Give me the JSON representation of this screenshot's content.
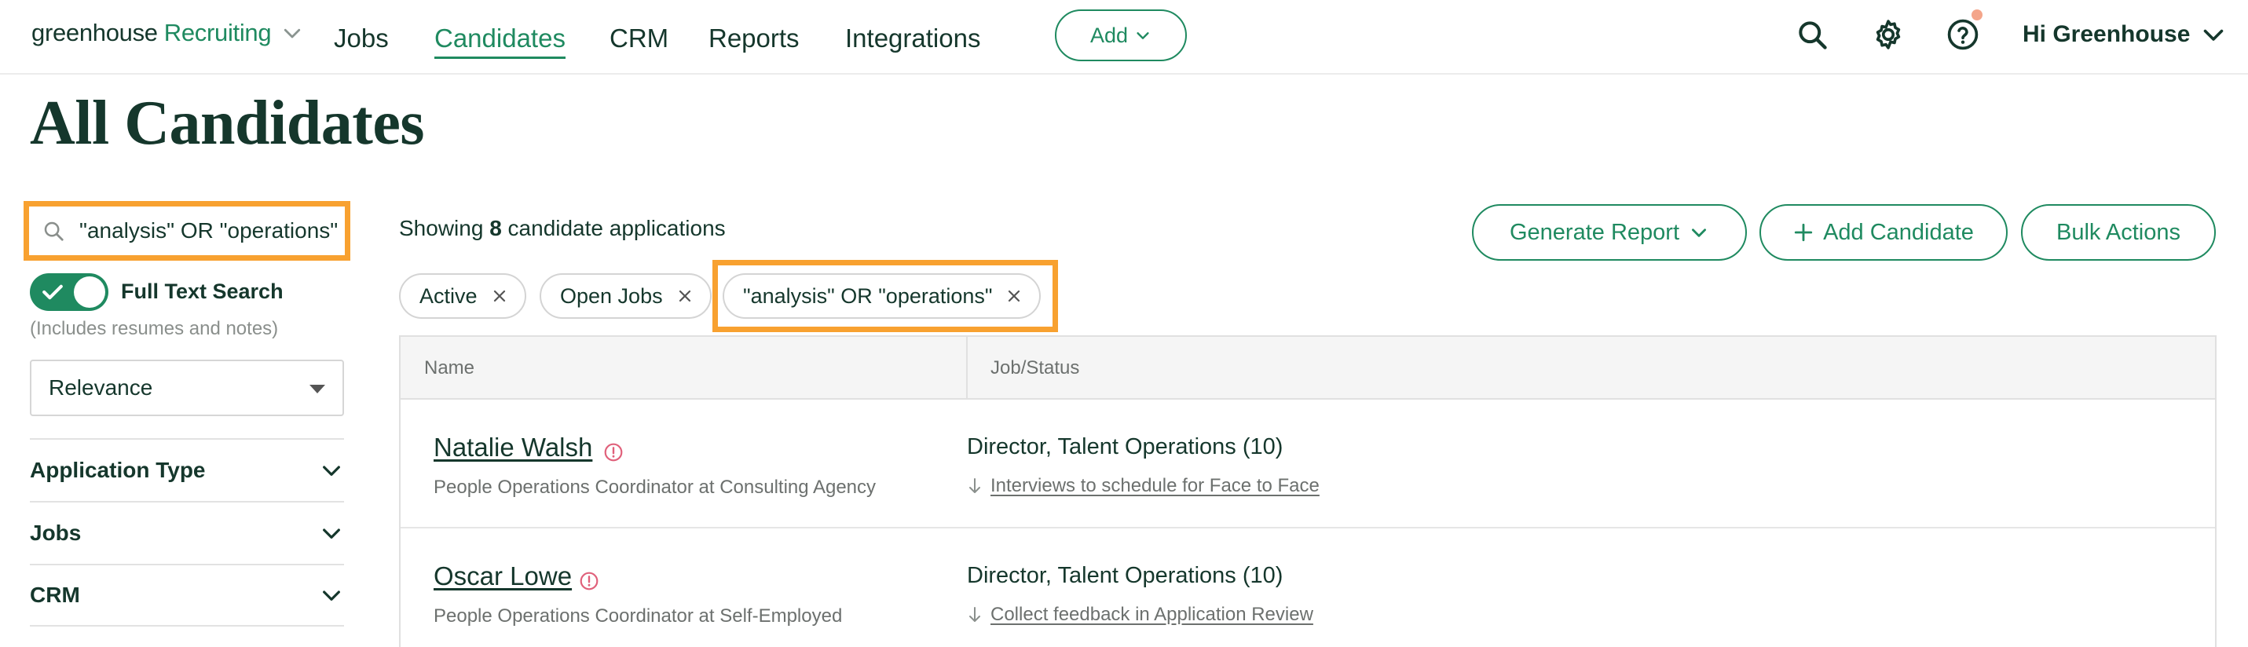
{
  "nav": {
    "brand_main": "greenhouse",
    "brand_product": "Recruiting",
    "links": {
      "jobs": "Jobs",
      "candidates": "Candidates",
      "crm": "CRM",
      "reports": "Reports",
      "integrations": "Integrations"
    },
    "add_label": "Add",
    "user_greeting": "Hi Greenhouse",
    "accent_color": "#1f8a60",
    "icons": [
      "search-icon",
      "gear-icon",
      "help-icon",
      "chevron-down-icon"
    ]
  },
  "page": {
    "title": "All Candidates"
  },
  "sidebar": {
    "search_value": "\"analysis\" OR \"operations\"",
    "full_text_search_label": "Full Text Search",
    "full_text_search_on": true,
    "full_text_search_note": "(Includes resumes and notes)",
    "sort_value": "Relevance",
    "filter_sections": [
      "Application Type",
      "Jobs",
      "CRM"
    ]
  },
  "main": {
    "showing_prefix": "Showing",
    "showing_count": "8",
    "showing_suffix": "candidate applications",
    "buttons": {
      "generate_report": "Generate Report",
      "add_candidate": "Add Candidate",
      "bulk_actions": "Bulk Actions"
    },
    "chips": [
      "Active",
      "Open Jobs",
      "\"analysis\" OR \"operations\""
    ],
    "highlight_color": "#f8a130",
    "table": {
      "headers": [
        "Name",
        "Job/Status"
      ],
      "rows": [
        {
          "name": "Natalie Walsh",
          "subtitle": "People Operations Coordinator at Consulting Agency",
          "job": "Director, Talent Operations (10)",
          "status": "Interviews to schedule for Face to Face"
        },
        {
          "name": "Oscar Lowe",
          "subtitle": "People Operations Coordinator at Self-Employed",
          "job": "Director, Talent Operations (10)",
          "status": "Collect feedback in Application Review"
        }
      ]
    }
  }
}
